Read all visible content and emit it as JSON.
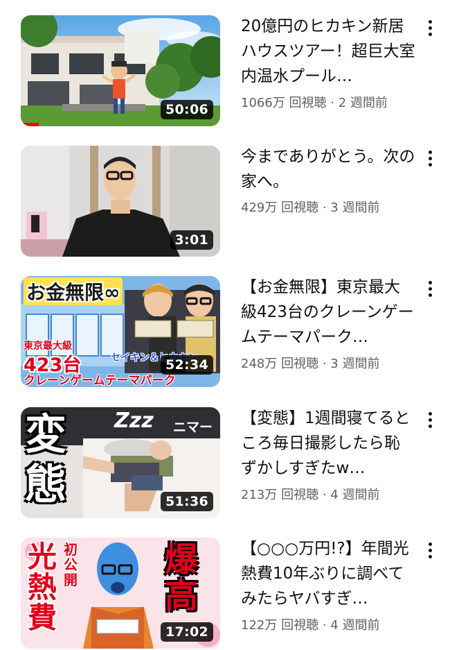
{
  "videos": [
    {
      "title": "20億円のヒカキン新居ハウスツアー！超巨大室内温水プール…",
      "views": "1066万 回視聴",
      "sep": "·",
      "age": "2 週間前",
      "duration": "50:06",
      "watched": 0.09
    },
    {
      "title": "今までありがとう。次の家へ。",
      "views": "429万 回視聴",
      "sep": "·",
      "age": "3 週間前",
      "duration": "3:01"
    },
    {
      "title": "【お金無限】東京最大級423台のクレーンゲームテーマパーク…",
      "views": "248万 回視聴",
      "sep": "·",
      "age": "3 週間前",
      "duration": "52:34",
      "thumb_text": {
        "top": "お金無限∞",
        "sub": "東京最大級",
        "big": "423台",
        "bottom": "クレーンゲームテーマパーク",
        "names": "セイキン＆ヒカキン"
      }
    },
    {
      "title": "【変態】1週間寝てるところ毎日撮影したら恥ずかしすぎたw…",
      "views": "213万 回視聴",
      "sep": "·",
      "age": "4 週間前",
      "duration": "51:36",
      "thumb_text": {
        "big1": "変",
        "big2": "態",
        "zzz": "Zzz",
        "nimar": "ニマー"
      }
    },
    {
      "title": "【○○○万円!?】年間光熱費10年ぶりに調べてみたらヤバすぎ…",
      "views": "122万 回視聴",
      "sep": "·",
      "age": "4 週間前",
      "duration": "17:02",
      "thumb_text": {
        "left": "光熱費",
        "first": "初公開",
        "right": "爆高"
      }
    }
  ],
  "colors": {
    "progress": "#ff0000",
    "text": "#0f0f0f",
    "meta": "#606060"
  },
  "icons": {
    "menu": "more-vert-icon"
  }
}
